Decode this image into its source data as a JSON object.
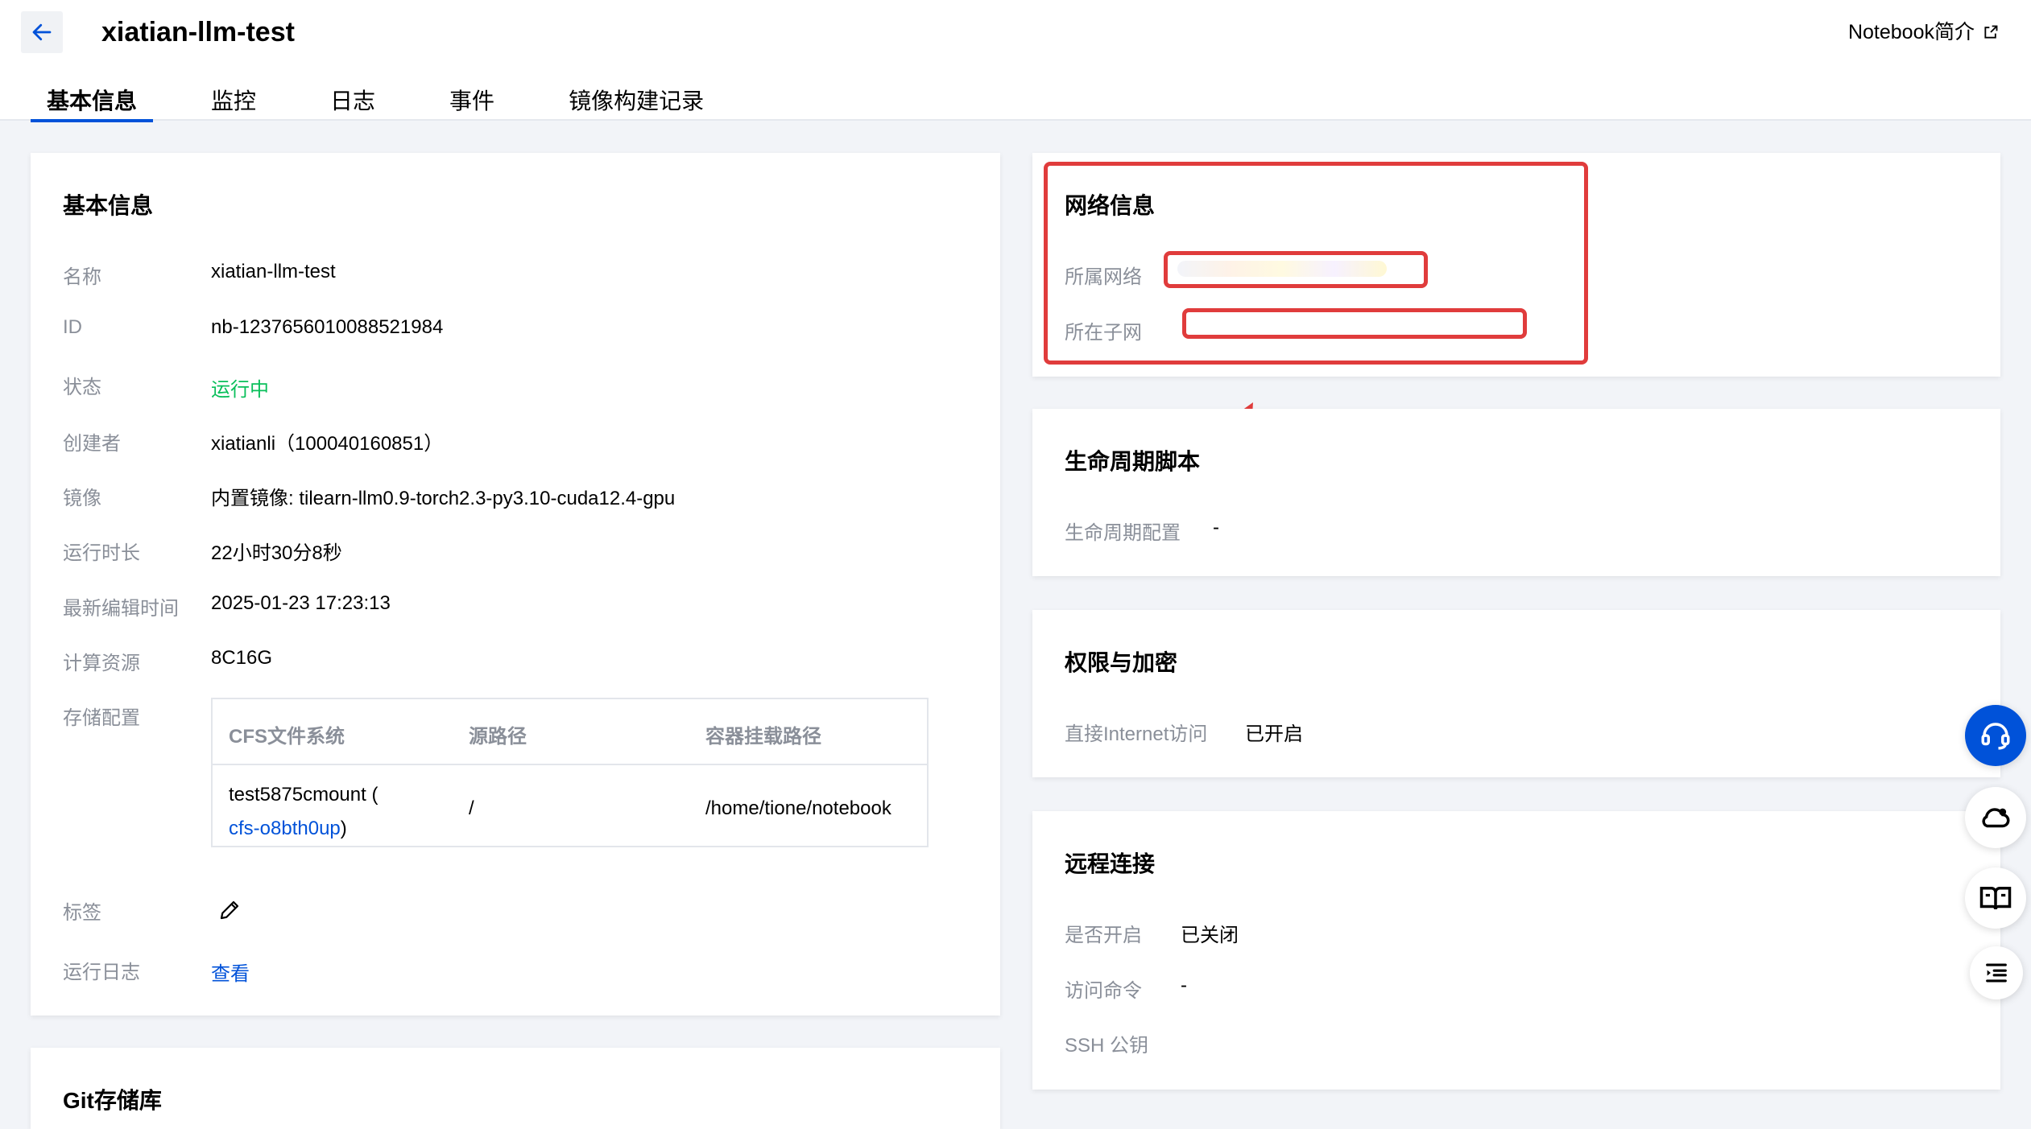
{
  "header": {
    "title": "xiatian-llm-test",
    "intro_link": "Notebook简介"
  },
  "tabs": [
    "基本信息",
    "监控",
    "日志",
    "事件",
    "镜像构建记录"
  ],
  "basic_info": {
    "title": "基本信息",
    "rows": [
      {
        "label": "名称",
        "value": "xiatian-llm-test"
      },
      {
        "label": "ID",
        "value": "nb-1237656010088521984"
      },
      {
        "label": "状态",
        "value": "运行中"
      },
      {
        "label": "创建者",
        "value": "xiatianli（100040160851）"
      },
      {
        "label": "镜像",
        "value": "内置镜像: tilearn-llm0.9-torch2.3-py3.10-cuda12.4-gpu"
      },
      {
        "label": "运行时长",
        "value": "22小时30分8秒"
      },
      {
        "label": "最新编辑时间",
        "value": "2025-01-23 17:23:13"
      },
      {
        "label": "计算资源",
        "value": "8C16G"
      }
    ],
    "storage_label": "存储配置",
    "storage_table": {
      "headers": [
        "CFS文件系统",
        "源路径",
        "容器挂载路径"
      ],
      "row": {
        "fs_name": "test5875cmount (",
        "fs_id": "cfs-o8bth0up",
        "fs_close": ")",
        "source": "/",
        "mount": "/home/tione/notebook"
      }
    },
    "tags_label": "标签",
    "log_label": "运行日志",
    "log_link": "查看"
  },
  "git": {
    "title": "Git存储库"
  },
  "network": {
    "title": "网络信息",
    "vpc_label": "所属网络",
    "subnet_label": "所在子网"
  },
  "lifecycle": {
    "title": "生命周期脚本",
    "label": "生命周期配置",
    "value": "-"
  },
  "permissions": {
    "title": "权限与加密",
    "label": "直接Internet访问",
    "value": "已开启"
  },
  "remote": {
    "title": "远程连接",
    "rows": [
      {
        "label": "是否开启",
        "value": "已关闭"
      },
      {
        "label": "访问命令",
        "value": "-"
      },
      {
        "label": "SSH 公钥",
        "value": ""
      }
    ]
  },
  "colors": {
    "accent": "#0052d9",
    "success": "#0abf5b",
    "annotation": "#e03c3c"
  },
  "icons": [
    "arrow-left-icon",
    "external-link-icon",
    "pencil-icon",
    "headset-icon",
    "cloud-user-icon",
    "book-icon",
    "menu-indent-icon"
  ]
}
